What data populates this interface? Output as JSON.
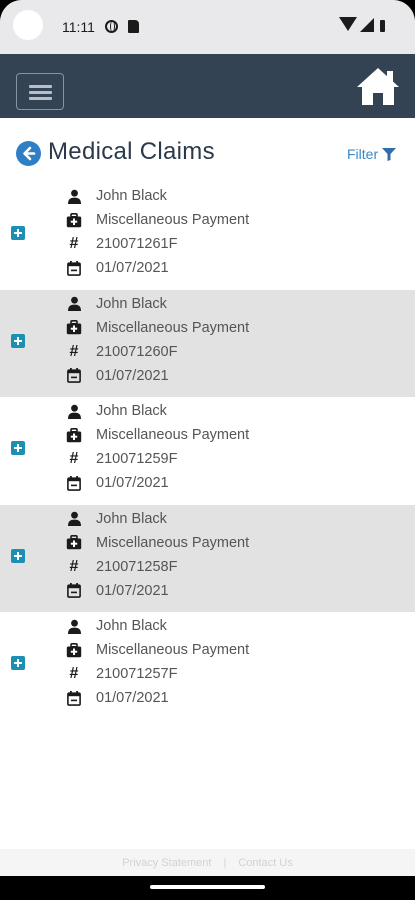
{
  "status_bar": {
    "time": "11:11",
    "icons": [
      "globe-icon",
      "sim-card-icon",
      "wifi-icon",
      "signal-icon",
      "battery-icon"
    ]
  },
  "header": {
    "menu_icon": "hamburger-icon",
    "home_icon": "home-icon",
    "background_color": "#344354"
  },
  "title_row": {
    "title": "Medical Claims",
    "back_icon": "arrow-left-circle-icon",
    "filter_label": "Filter",
    "filter_icon": "funnel-icon",
    "accent_color": "#2f7fc4"
  },
  "claims": [
    {
      "name": "John Black",
      "type": "Miscellaneous Payment",
      "claim_number": "210071261F",
      "date": "01/07/2021"
    },
    {
      "name": "John Black",
      "type": "Miscellaneous Payment",
      "claim_number": "210071260F",
      "date": "01/07/2021"
    },
    {
      "name": "John Black",
      "type": "Miscellaneous Payment",
      "claim_number": "210071259F",
      "date": "01/07/2021"
    },
    {
      "name": "John Black",
      "type": "Miscellaneous Payment",
      "claim_number": "210071258F",
      "date": "01/07/2021"
    },
    {
      "name": "John Black",
      "type": "Miscellaneous Payment",
      "claim_number": "210071257F",
      "date": "01/07/2021"
    }
  ],
  "claim_icons": {
    "name": "user-icon",
    "type": "medical-bag-icon",
    "claim_number": "hash-icon",
    "date": "calendar-icon",
    "expand": "plus-square-icon"
  },
  "footer": {
    "privacy_label": "Privacy Statement",
    "separator": "|",
    "contact_label": "Contact Us"
  }
}
